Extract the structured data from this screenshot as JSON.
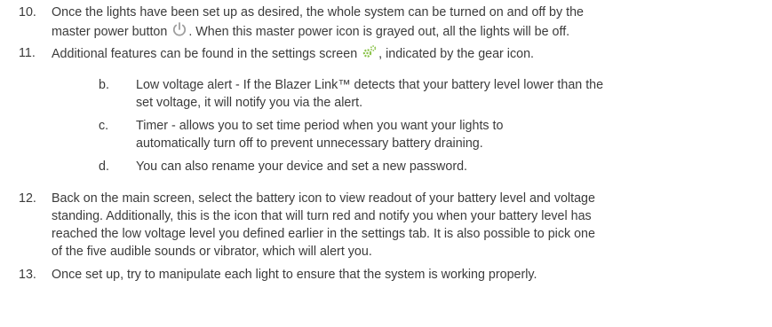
{
  "steps": [
    {
      "number": "10.",
      "line1": "Once the lights have been set up as desired, the whole system can be turned on and off by the",
      "line2_before": "master power button",
      "icon": "power-icon",
      "line2_after": ". When this master power icon is grayed out, all the lights will be off."
    },
    {
      "number": "11.",
      "line1_before": "Additional features can be found in the settings screen",
      "icon": "gear-icon",
      "line1_after": ", indicated by the gear  icon.",
      "icon_color": "#8bc34a"
    },
    {
      "number": "b.",
      "lines": [
        "Low voltage alert - If the Blazer Link™ detects that your battery level lower than the",
        "set voltage, it will notify you via the alert."
      ]
    },
    {
      "number": "c.",
      "lines": [
        "Timer - allows you to set time period when you want your lights to",
        "automatically turn off to prevent unnecessary battery draining."
      ]
    },
    {
      "number": "d.",
      "lines": [
        "You can also rename your device and set a new password."
      ]
    },
    {
      "number": "12.",
      "lines": [
        "Back on the main screen, select the battery icon to view readout of your battery level and voltage",
        "standing. Additionally, this is the icon that will turn red and notify you when your battery level has",
        "reached the low voltage level you defined earlier in the settings tab. It is also possible to pick one",
        "of the five audible sounds or vibrator, which will alert you."
      ]
    },
    {
      "number": "13.",
      "lines": [
        "Once set up, try to manipulate each light to ensure that the system is working properly."
      ]
    }
  ]
}
